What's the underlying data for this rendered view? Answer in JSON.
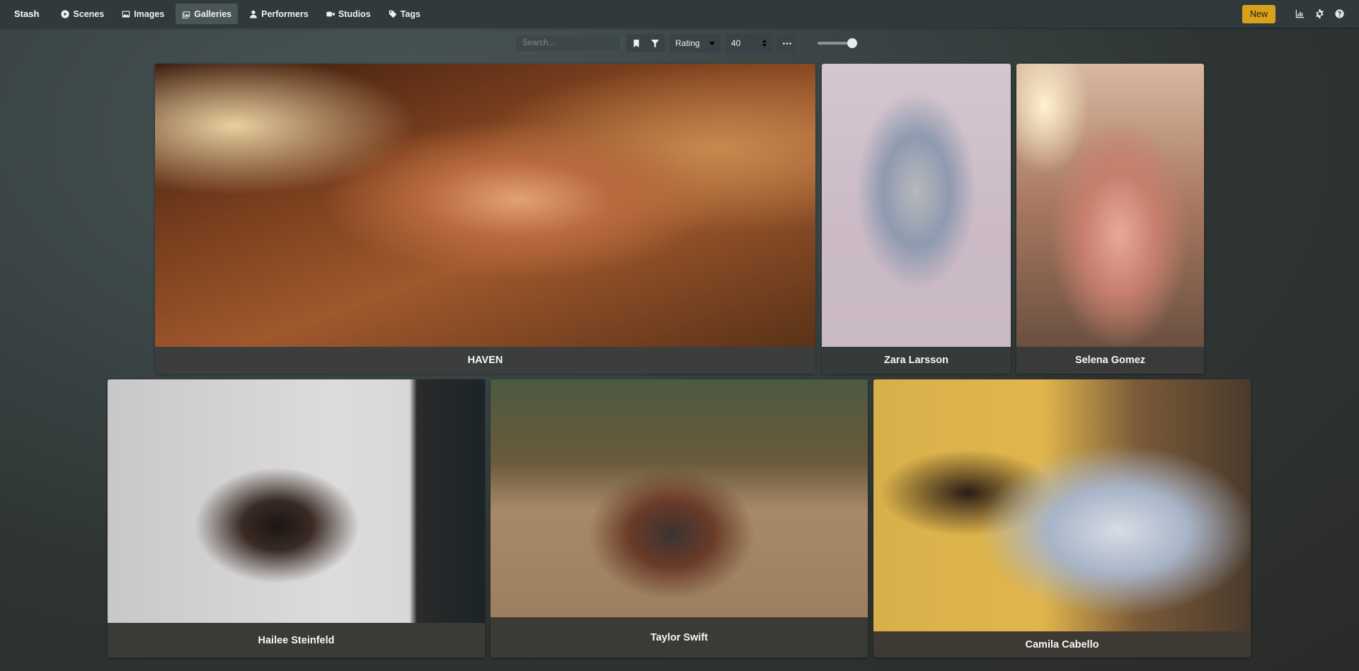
{
  "navbar": {
    "brand": "Stash",
    "items": [
      {
        "label": "Scenes",
        "icon": "play-circle-icon"
      },
      {
        "label": "Images",
        "icon": "image-icon"
      },
      {
        "label": "Galleries",
        "icon": "images-icon",
        "active": true
      },
      {
        "label": "Performers",
        "icon": "user-icon"
      },
      {
        "label": "Studios",
        "icon": "video-icon"
      },
      {
        "label": "Tags",
        "icon": "tag-icon"
      }
    ],
    "new_label": "New",
    "right_icons": [
      "chart-icon",
      "gear-icon",
      "help-icon"
    ],
    "accent_color": "#d9a11a"
  },
  "toolbar": {
    "search_placeholder": "Search...",
    "sort_by": "Rating",
    "per_page": "40",
    "zoom_level": 1.0
  },
  "galleries": [
    {
      "title": "HAVEN"
    },
    {
      "title": "Zara Larsson"
    },
    {
      "title": "Selena Gomez"
    },
    {
      "title": "Hailee Steinfeld"
    },
    {
      "title": "Taylor Swift"
    },
    {
      "title": "Camila Cabello"
    }
  ]
}
